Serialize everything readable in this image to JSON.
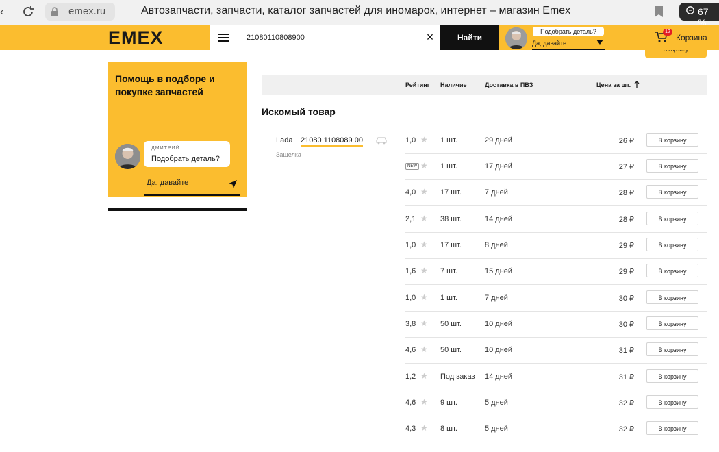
{
  "browser": {
    "url": "emex.ru",
    "tab_title": "Автозапчасти, запчасти, каталог запчастей для иномарок, интернет – магазин Emex",
    "zoom": "67 %"
  },
  "header": {
    "logo": "EMEX",
    "search_value": "21080110808900",
    "find_label": "Найти",
    "assistant_question": "Подобрать деталь?",
    "assistant_answer": "Да, давайте",
    "cart_count": "12",
    "cart_label": "Корзина",
    "peek_button": "В корзину"
  },
  "promo": {
    "title": "Помощь в подборе и покупке запчастей",
    "consultant_name": "ДМИТРИЙ",
    "question": "Подобрать деталь?",
    "answer": "Да, давайте"
  },
  "table": {
    "columns": {
      "rating": "Рейтинг",
      "stock": "Наличие",
      "delivery": "Доставка в ПВЗ",
      "price": "Цена за шт."
    },
    "section_title": "Искомый товар",
    "product": {
      "brand": "Lada",
      "number": "21080 1108089 00",
      "description": "Защелка"
    },
    "cart_button": "В корзину",
    "new_badge": "NEW",
    "rows": [
      {
        "rating": "1,0",
        "stock": "1 шт.",
        "delivery": "29 дней",
        "price": "26 ₽"
      },
      {
        "rating": "",
        "is_new": true,
        "stock": "1 шт.",
        "delivery": "17 дней",
        "price": "27 ₽"
      },
      {
        "rating": "4,0",
        "stock": "17 шт.",
        "delivery": "7 дней",
        "price": "28 ₽"
      },
      {
        "rating": "2,1",
        "stock": "38 шт.",
        "delivery": "14 дней",
        "price": "28 ₽"
      },
      {
        "rating": "1,0",
        "stock": "17 шт.",
        "delivery": "8 дней",
        "price": "29 ₽"
      },
      {
        "rating": "1,6",
        "stock": "7 шт.",
        "delivery": "15 дней",
        "price": "29 ₽"
      },
      {
        "rating": "1,0",
        "stock": "1 шт.",
        "delivery": "7 дней",
        "price": "30 ₽"
      },
      {
        "rating": "3,8",
        "stock": "50 шт.",
        "delivery": "10 дней",
        "price": "30 ₽"
      },
      {
        "rating": "4,6",
        "stock": "50 шт.",
        "delivery": "10 дней",
        "price": "31 ₽"
      },
      {
        "rating": "1,2",
        "stock": "Под заказ",
        "delivery": "14 дней",
        "price": "31 ₽"
      },
      {
        "rating": "4,6",
        "stock": "9 шт.",
        "delivery": "5 дней",
        "price": "32 ₽"
      },
      {
        "rating": "4,3",
        "stock": "8 шт.",
        "delivery": "5 дней",
        "price": "32 ₽"
      }
    ]
  },
  "colors": {
    "accent": "#fbbd2f",
    "dark": "#111111"
  },
  "icons": [
    "back-icon",
    "reload-icon",
    "lock-icon",
    "bookmark-icon",
    "zoom-icon",
    "menu-icon",
    "close-icon",
    "cart-icon",
    "send-icon",
    "star-icon",
    "car-icon"
  ]
}
